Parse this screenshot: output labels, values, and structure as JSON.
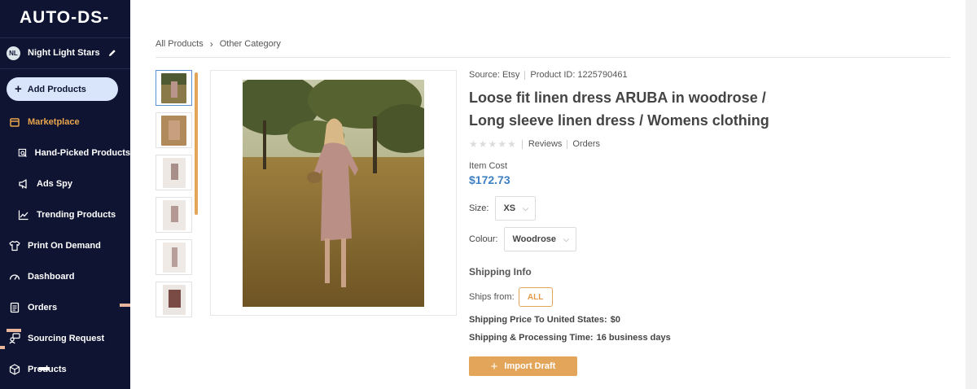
{
  "app": {
    "logo_text": "AUTO-DS-"
  },
  "sidebar": {
    "store": {
      "initials": "NL",
      "name": "Night Light Stars"
    },
    "add_button": "Add Products",
    "items": [
      {
        "label": "Marketplace",
        "icon": "marketplace-icon",
        "active": true
      },
      {
        "label": "Hand-Picked Products",
        "icon": "hand-picked-icon"
      },
      {
        "label": "Ads Spy",
        "icon": "megaphone-icon"
      },
      {
        "label": "Trending Products",
        "icon": "trending-icon"
      },
      {
        "label": "Print On Demand",
        "icon": "shirt-icon"
      },
      {
        "label": "Dashboard",
        "icon": "gauge-icon"
      },
      {
        "label": "Orders",
        "icon": "clipboard-icon"
      },
      {
        "label": "Sourcing Request",
        "icon": "sourcing-icon"
      },
      {
        "label": "Products",
        "icon": "box-icon"
      }
    ]
  },
  "breadcrumb": {
    "root": "All Products",
    "current": "Other Category"
  },
  "product": {
    "source": "Source: Etsy",
    "product_id": "Product ID: 1225790461",
    "title": "Loose fit linen dress ARUBA in woodrose / Long sleeve linen dress / Womens clothing",
    "reviews_label": "Reviews",
    "orders_label": "Orders",
    "rating": 0,
    "item_cost_label": "Item Cost",
    "price": "$172.73",
    "size_label": "Size:",
    "size_value": "XS",
    "colour_label": "Colour:",
    "colour_value": "Woodrose"
  },
  "shipping": {
    "title": "Shipping Info",
    "ships_from_label": "Ships from:",
    "ships_from_value": "ALL",
    "price_label": "Shipping Price To United States:",
    "price_value": "$0",
    "time_label": "Shipping & Processing Time:",
    "time_value": "16 business days"
  },
  "actions": {
    "import_label": "Import Draft"
  },
  "colors": {
    "sidebar_bg": "#0f1432",
    "accent": "#e3a55a",
    "price": "#3e7fc3",
    "active_nav": "#e8a54b"
  }
}
